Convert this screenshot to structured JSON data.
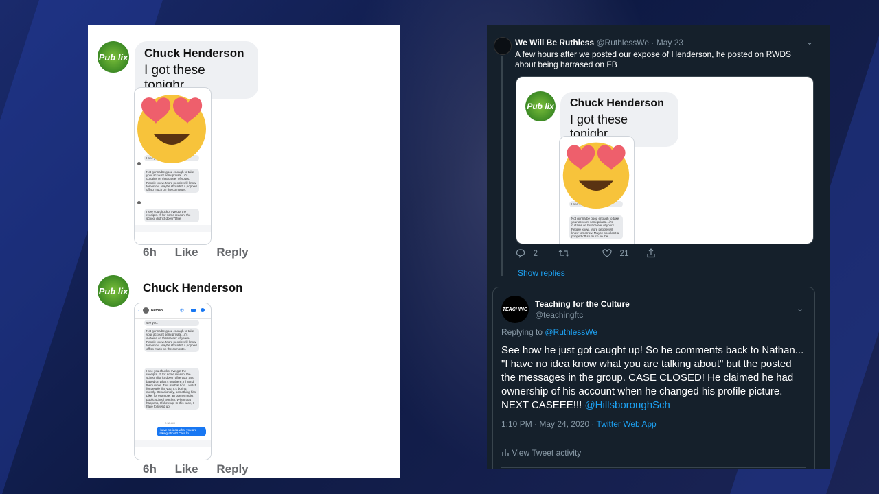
{
  "facebook": {
    "comment1": {
      "avatar_text": "Pub lix",
      "name": "Chuck Henderson",
      "message": "I got these tonighr",
      "time": "6h",
      "like": "Like",
      "reply": "Reply"
    },
    "comment2": {
      "avatar_text": "Pub lix",
      "name": "Chuck Henderson",
      "time": "6h",
      "like": "Like",
      "reply": "Reply"
    },
    "screenshot1_msgs": [
      "I see you. ...all see you.",
      "Not gonna be good enough to take your account semi private...it's curtains on that career of yours. People know. More people will know tomorrow. Maybe shouldn't a popped off so much on the computer.",
      "I see you chucko. I've got the receipts. If, for some reason, the school district doesn't fire"
    ],
    "screenshot2": {
      "contact": "Nathan",
      "msgs": [
        "see you.",
        "Not gonna be good enough to take your account semi private...it's curtains on that career of yours. People know. More people will know tomorrow. Maybe shouldn't a popped off so much on the computer.",
        "I see you chucko. I've got the receipts. If, for some reason, the school district doesn't fire your ass based on what's out there, I'll send them more. This is what I do. I watch for people like you. It's boring, mostly. Occasionally, something hits. Like, for example, an openly racist public school teacher. When that happens, I follow up. In this case, I have followed up."
      ],
      "timestamp": "2:38 AM",
      "reply": "I have no idea what you are talking about? Care to"
    }
  },
  "twitter": {
    "tweet": {
      "name": "We Will Be Ruthless",
      "handle": "@RuthlessWe",
      "date": "· May 23",
      "text": "A few hours after we posted our expose of Henderson, he posted on RWDS about being harrased on FB",
      "replies": "2",
      "likes": "21",
      "show_replies": "Show replies"
    },
    "embedded": {
      "avatar_text": "Pub lix",
      "name": "Chuck Henderson",
      "message": "I got these tonighr",
      "msgs": [
        "I see ... all see you.",
        "Not gonna be good enough to take your account semi private...it's curtains on that career of yours. People know. More people will know tomorrow. Maybe shouldn't a popped off so much on the"
      ]
    },
    "reply_tweet": {
      "avatar_text": "TEACHING",
      "name": "Teaching for the Culture",
      "handle": "@teachingftc",
      "replying_prefix": "Replying to",
      "replying_to": "@RuthlessWe",
      "body": "See how he just got caught up! So he comments back to Nathan... \"I have no idea know what you are talking about\" but the posted the messages in the group. CASE CLOSED! He claimed he had ownership of his account when he changed his profile picture. NEXT CASEEE!!!",
      "mention": "@HillsboroughSch",
      "meta": "1:10 PM · May 24, 2020 ·",
      "app": "Twitter Web App",
      "activity": "View Tweet activity"
    }
  },
  "colors": {
    "twitter_bg": "#15202b",
    "twitter_blue": "#1da1f2",
    "fb_green": "#3d8a25",
    "bg": "#1a2a6c"
  },
  "icons": [
    "reply-icon",
    "retweet-icon",
    "like-icon",
    "share-icon",
    "activity-icon",
    "chevron-down-icon",
    "heart-eyes-emoji"
  ]
}
